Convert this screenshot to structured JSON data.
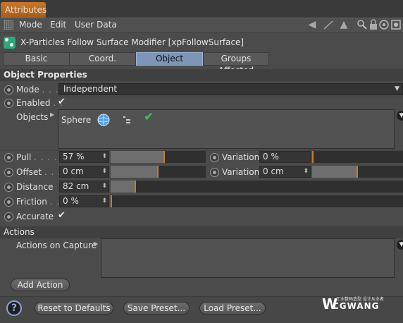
{
  "window": {
    "tab_title": "Attributes"
  },
  "menubar": {
    "items": [
      "Mode",
      "Edit",
      "User Data"
    ],
    "icons": [
      "arrow-left-icon",
      "arrow-pointer-icon",
      "up-arrow-icon",
      "search-icon",
      "lock-icon",
      "target-icon",
      "settings-icon"
    ]
  },
  "object": {
    "title": "X-Particles Follow Surface Modifier [xpFollowSurface]"
  },
  "tabs": [
    "Basic",
    "Coord.",
    "Object",
    "Groups Affected"
  ],
  "active_tab": "Object",
  "sections": {
    "object_properties": "Object Properties",
    "actions": "Actions"
  },
  "params": {
    "mode": {
      "label": "Mode",
      "dots": ". . . .",
      "value": "Independent"
    },
    "enabled": {
      "label": "Enabled",
      "dots": ". .",
      "checked": true,
      "mark": "✔"
    },
    "objects": {
      "label": "Objects",
      "item": "Sphere",
      "check": "✔"
    },
    "pull": {
      "label": "Pull",
      "dots": ". . . . . .",
      "value": "57 %",
      "fraction": 0.57
    },
    "pull_variation": {
      "label": "Variation",
      "value": "0 %",
      "fraction": 0.0
    },
    "offset": {
      "label": "Offset",
      "dots": ". . . .",
      "value": "0 cm",
      "fraction": 0.5
    },
    "offset_variation": {
      "label": "Variation",
      "value": "0 cm",
      "fraction": 0.5
    },
    "distance": {
      "label": "Distance",
      "value": "82 cm",
      "fraction": 0.25
    },
    "friction": {
      "label": "Friction",
      "dots": ". .",
      "value": "0 %",
      "fraction": 0.0
    },
    "accurate": {
      "label": "Accurate",
      "checked": true,
      "mark": "✔"
    }
  },
  "actions": {
    "label": "Actions on Capture",
    "add_button": "Add Action"
  },
  "footer": {
    "reset": "Reset to Defaults",
    "save": "Save Preset...",
    "load": "Load Preset...",
    "help": "?"
  },
  "watermark": {
    "brand": "CGWANG",
    "tagline": "工业数码造型 设计从业者"
  },
  "colors": {
    "accent_orange": "#c47d2a",
    "active_tab": "#7d95b6",
    "icon_green": "#2fa77a",
    "check_green": "#3fc35a"
  }
}
